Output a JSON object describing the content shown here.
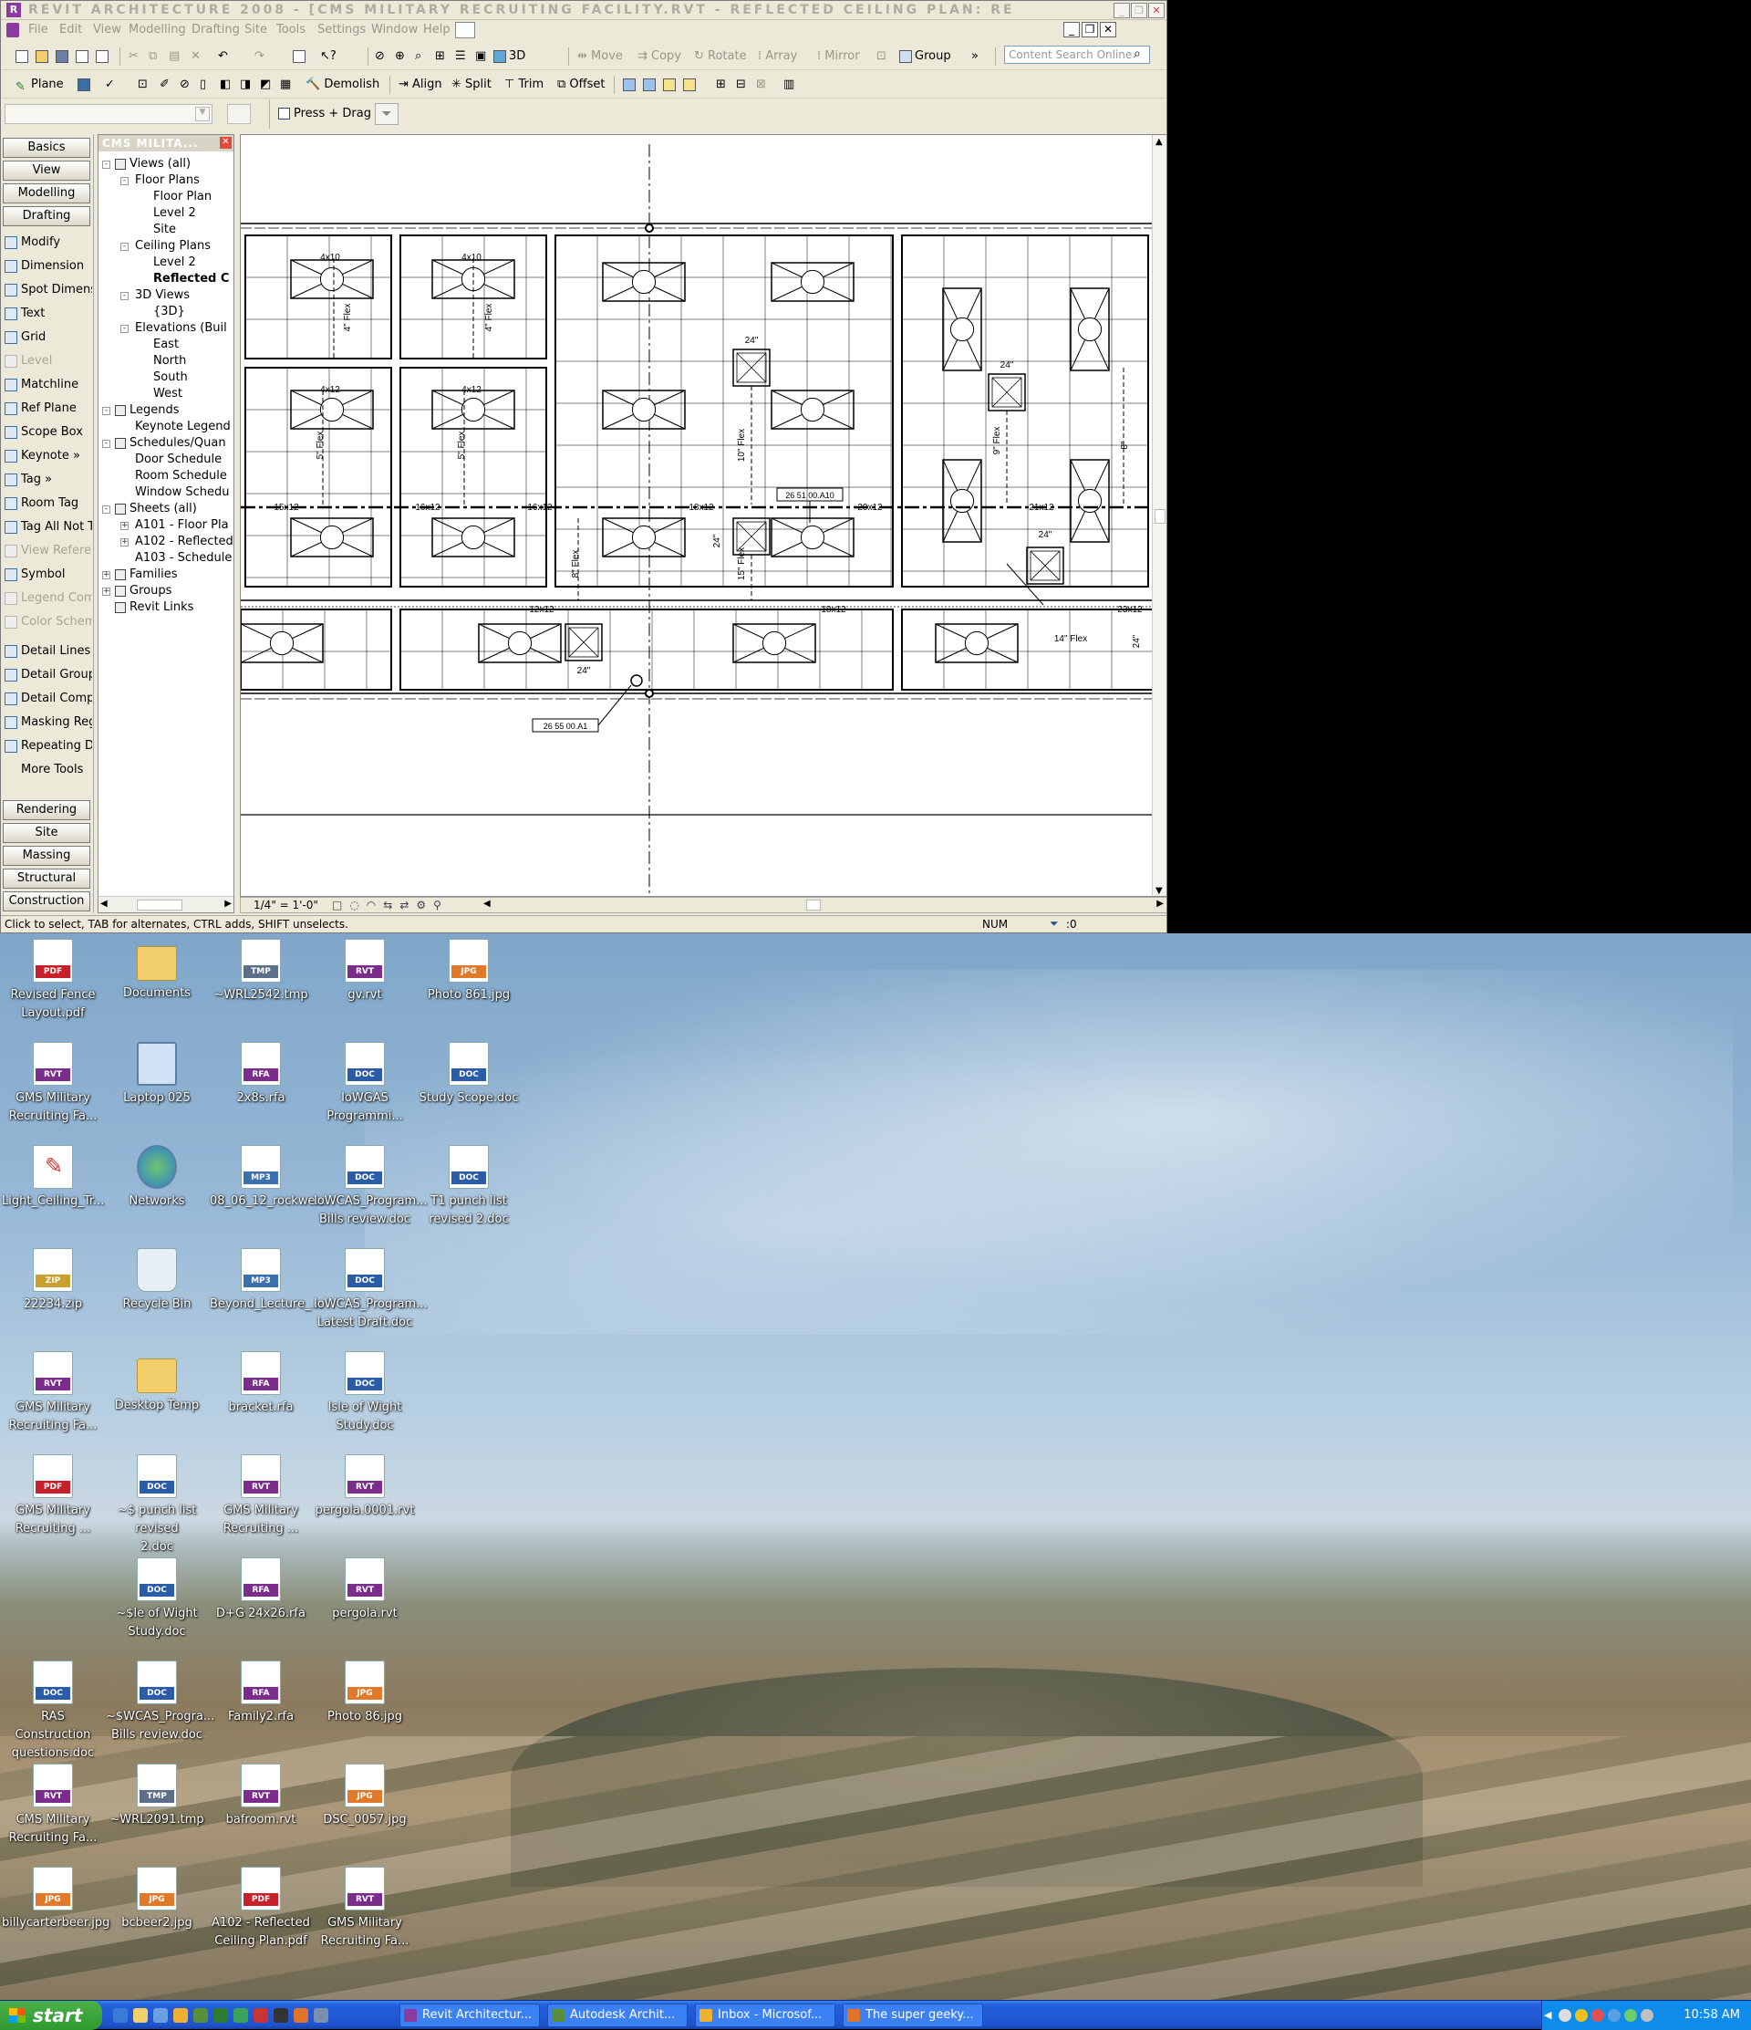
{
  "revit": {
    "title": "REVIT ARCHITECTURE 2008 - [CMS MILITARY RECRUITING FACILITY.RVT - REFLECTED CEILING PLAN: RE",
    "menus": [
      "File",
      "Edit",
      "View",
      "Modelling",
      "Drafting",
      "Site",
      "Tools",
      "Settings",
      "Window",
      "Help"
    ],
    "toolbar1": {
      "three_d": "3D",
      "move": "Move",
      "copy": "Copy",
      "rotate": "Rotate",
      "array": "Array",
      "mirror": "Mirror",
      "group": "Group",
      "search_placeholder": "Content Search Online"
    },
    "toolbar2": {
      "plane": "Plane",
      "demolish": "Demolish",
      "align": "Align",
      "split": "Split",
      "trim": "Trim",
      "offset": "Offset"
    },
    "options_bar": {
      "press_drag": "Press + Drag"
    },
    "design_tabs_top": [
      "Basics",
      "View",
      "Modelling",
      "Drafting"
    ],
    "drafting_tools": [
      {
        "label": "Modify",
        "enabled": true
      },
      {
        "label": "Dimension",
        "enabled": true
      },
      {
        "label": "Spot Dimensi",
        "enabled": true
      },
      {
        "label": "Text",
        "enabled": true
      },
      {
        "label": "Grid",
        "enabled": true
      },
      {
        "label": "Level",
        "enabled": false
      },
      {
        "label": "Matchline",
        "enabled": true
      },
      {
        "label": "Ref Plane",
        "enabled": true
      },
      {
        "label": "Scope Box",
        "enabled": true
      },
      {
        "label": "Keynote »",
        "enabled": true
      },
      {
        "label": "Tag »",
        "enabled": true
      },
      {
        "label": "Room Tag",
        "enabled": true
      },
      {
        "label": "Tag All Not T",
        "enabled": true
      },
      {
        "label": "View Referen",
        "enabled": false
      },
      {
        "label": "Symbol",
        "enabled": true
      },
      {
        "label": "Legend Com",
        "enabled": false
      },
      {
        "label": "Color Schem",
        "enabled": false
      },
      {
        "label": "Detail Lines",
        "enabled": true
      },
      {
        "label": "Detail Group",
        "enabled": true
      },
      {
        "label": "Detail Compo",
        "enabled": true
      },
      {
        "label": "Masking Reg",
        "enabled": true
      },
      {
        "label": "Repeating De",
        "enabled": true
      },
      {
        "label": "More Tools",
        "enabled": true
      }
    ],
    "design_tabs_bottom": [
      "Rendering",
      "Site",
      "Massing",
      "Structural",
      "Construction"
    ],
    "browser": {
      "header": "CMS MILITA...",
      "nodes": [
        {
          "label": "Views (all)",
          "level": 0,
          "exp": "-"
        },
        {
          "label": "Floor Plans",
          "level": 1,
          "exp": "-"
        },
        {
          "label": "Floor Plan",
          "level": 2
        },
        {
          "label": "Level 2",
          "level": 2
        },
        {
          "label": "Site",
          "level": 2
        },
        {
          "label": "Ceiling Plans",
          "level": 1,
          "exp": "-"
        },
        {
          "label": "Level 2",
          "level": 2
        },
        {
          "label": "Reflected C",
          "level": 2,
          "bold": true
        },
        {
          "label": "3D Views",
          "level": 1,
          "exp": "-"
        },
        {
          "label": "{3D}",
          "level": 2
        },
        {
          "label": "Elevations (Buil",
          "level": 1,
          "exp": "-"
        },
        {
          "label": "East",
          "level": 2
        },
        {
          "label": "North",
          "level": 2
        },
        {
          "label": "South",
          "level": 2
        },
        {
          "label": "West",
          "level": 2
        },
        {
          "label": "Legends",
          "level": 0,
          "exp": "-"
        },
        {
          "label": "Keynote Legend",
          "level": 1
        },
        {
          "label": "Schedules/Quan",
          "level": 0,
          "exp": "-"
        },
        {
          "label": "Door Schedule",
          "level": 1
        },
        {
          "label": "Room Schedule",
          "level": 1
        },
        {
          "label": "Window Schedu",
          "level": 1
        },
        {
          "label": "Sheets (all)",
          "level": 0,
          "exp": "-"
        },
        {
          "label": "A101 - Floor Pla",
          "level": 1,
          "exp": "+"
        },
        {
          "label": "A102 - Reflected",
          "level": 1,
          "exp": "+"
        },
        {
          "label": "A103 - Schedule",
          "level": 1
        },
        {
          "label": "Families",
          "level": 0,
          "exp": "+"
        },
        {
          "label": "Groups",
          "level": 0,
          "exp": "+"
        },
        {
          "label": "Revit Links",
          "level": 0
        }
      ]
    },
    "drawing": {
      "labels": {
        "l4x10a": "4x10",
        "l4x10b": "4x10",
        "l4x12a": "4x12",
        "l4x12b": "4x12",
        "flex4a": "4\" Flex",
        "flex4b": "4\" Flex",
        "flex5a": "5\" Flex",
        "flex5b": "5\" Flex",
        "flex10": "10\" Flex",
        "flex15": "15\" Flex",
        "flex8": "8\" Flex",
        "flex9": "9\" Flex",
        "flex8b": "8\"",
        "flex14": "14\" Flex",
        "d24a": "24\"",
        "d24b": "24\"",
        "d24c": "24\"",
        "d24d": "24\"",
        "d24e": "24\"",
        "d24f": "24\"",
        "r15x12": "15x12",
        "r16x12a": "16x12",
        "r16x12b": "16x12",
        "r18x12a": "18x12",
        "r20x12": "20x12",
        "r21x12": "21x12",
        "r12x12": "12x12",
        "r18x12b": "18x12",
        "r23x12": "23x12",
        "tag1": "26 51 00.A10",
        "tag2": "26 55 00.A1"
      }
    },
    "view_scale": "1/4\" = 1'-0\"",
    "status": {
      "hint": "Click to select, TAB for alternates, CTRL adds, SHIFT unselects.",
      "num": "NUM",
      "filter": ":0"
    }
  },
  "desktop": {
    "icons": [
      {
        "label": "Revised Fence\nLayout.pdf",
        "type": "pdf",
        "col": 0,
        "row": 0
      },
      {
        "label": "Documents",
        "type": "folder",
        "col": 1,
        "row": 0
      },
      {
        "label": "~WRL2542.tmp",
        "type": "tmp",
        "col": 2,
        "row": 0
      },
      {
        "label": "gv.rvt",
        "type": "rvt",
        "col": 3,
        "row": 0
      },
      {
        "label": "Photo 861.jpg",
        "type": "jpg",
        "col": 4,
        "row": 0
      },
      {
        "label": "GMS Military\nRecruiting Fa...",
        "type": "rvt",
        "col": 0,
        "row": 1
      },
      {
        "label": "Laptop 025",
        "type": "computer",
        "col": 1,
        "row": 1
      },
      {
        "label": "2x8s.rfa",
        "type": "rfa",
        "col": 2,
        "row": 1
      },
      {
        "label": "IoWGAS\nProgrammi...",
        "type": "doc",
        "col": 3,
        "row": 1
      },
      {
        "label": "Study Scope.doc",
        "type": "doc",
        "col": 4,
        "row": 1
      },
      {
        "label": "Light_Ceiling_Tr...",
        "type": "paint",
        "col": 0,
        "row": 2
      },
      {
        "label": "Networks",
        "type": "network",
        "col": 1,
        "row": 2
      },
      {
        "label": "08_06_12_rockwe...",
        "type": "mp3",
        "col": 2,
        "row": 2
      },
      {
        "label": "IoWCAS_Program...\nBills review.doc",
        "type": "doc",
        "col": 3,
        "row": 2
      },
      {
        "label": "T1 punch list\nrevised 2.doc",
        "type": "doc",
        "col": 4,
        "row": 2
      },
      {
        "label": "22234.zip",
        "type": "zip",
        "col": 0,
        "row": 3
      },
      {
        "label": "Recycle Bin",
        "type": "recycle",
        "col": 1,
        "row": 3
      },
      {
        "label": "Beyond_Lecture_...",
        "type": "mp3",
        "col": 2,
        "row": 3
      },
      {
        "label": "IoWCAS_Program...\nLatest Draft.doc",
        "type": "doc",
        "col": 3,
        "row": 3
      },
      {
        "label": "GMS Military\nRecruiting Fa...",
        "type": "rvt",
        "col": 0,
        "row": 4
      },
      {
        "label": "Desktop Temp",
        "type": "folder",
        "col": 1,
        "row": 4
      },
      {
        "label": "bracket.rfa",
        "type": "rfa",
        "col": 2,
        "row": 4
      },
      {
        "label": "Isle of Wight\nStudy.doc",
        "type": "doc",
        "col": 3,
        "row": 4
      },
      {
        "label": "GMS Military\nRecruiting ...",
        "type": "pdf",
        "col": 0,
        "row": 5
      },
      {
        "label": "~$ punch list revised\n2.doc",
        "type": "doc",
        "col": 1,
        "row": 5
      },
      {
        "label": "GMS Military\nRecruiting ...",
        "type": "rvt",
        "col": 2,
        "row": 5
      },
      {
        "label": "pergola.0001.rvt",
        "type": "rvt",
        "col": 3,
        "row": 5
      },
      {
        "label": "~$le of Wight\nStudy.doc",
        "type": "doc",
        "col": 1,
        "row": 6
      },
      {
        "label": "D+G 24x26.rfa",
        "type": "rfa",
        "col": 2,
        "row": 6
      },
      {
        "label": "pergola.rvt",
        "type": "rvt",
        "col": 3,
        "row": 6
      },
      {
        "label": "RAS Construction\nquestions.doc",
        "type": "doc",
        "col": 0,
        "row": 7
      },
      {
        "label": "~$WCAS_Progra...\nBills review.doc",
        "type": "doc",
        "col": 1,
        "row": 7
      },
      {
        "label": "Family2.rfa",
        "type": "rfa",
        "col": 2,
        "row": 7
      },
      {
        "label": "Photo 86.jpg",
        "type": "jpg",
        "col": 3,
        "row": 7
      },
      {
        "label": "CMS Military\nRecruiting Fa...",
        "type": "rvt",
        "col": 0,
        "row": 8
      },
      {
        "label": "~WRL2091.tmp",
        "type": "tmp",
        "col": 1,
        "row": 8
      },
      {
        "label": "bafroom.rvt",
        "type": "rvt",
        "col": 2,
        "row": 8
      },
      {
        "label": "DSC_0057.jpg",
        "type": "jpg",
        "col": 3,
        "row": 8
      },
      {
        "label": "billycarterbeer.jpg",
        "type": "jpg",
        "col": 0,
        "row": 9
      },
      {
        "label": "bcbeer2.jpg",
        "type": "jpg",
        "col": 1,
        "row": 9
      },
      {
        "label": "A102 - Reflected\nCeiling Plan.pdf",
        "type": "pdf",
        "col": 2,
        "row": 9
      },
      {
        "label": "GMS Military\nRecruiting Fa...",
        "type": "rvt",
        "col": 3,
        "row": 9
      }
    ]
  },
  "taskbar": {
    "start": "start",
    "tasks": [
      "Revit Architectur...",
      "Autodesk Archit...",
      "Inbox - Microsof...",
      "The super geeky..."
    ],
    "clock": "10:58 AM"
  },
  "colors": {
    "xp_blue": "#245edb",
    "start_green": "#3a9f3a",
    "tray": "#0f8bea"
  }
}
